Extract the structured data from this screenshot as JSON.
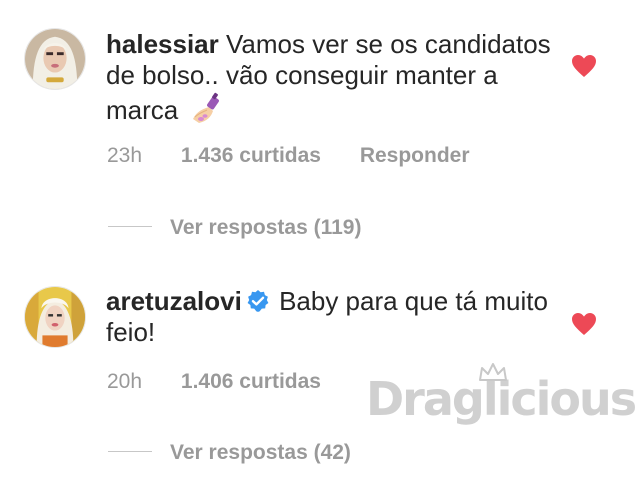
{
  "comments": [
    {
      "username": "halessiar",
      "text": "Vamos ver se os candidatos de bolso.. vão conseguir manter a marca",
      "emoji": "nail-polish",
      "time": "23h",
      "likes": "1.436 curtidas",
      "reply": "Responder",
      "view_replies": "Ver respostas (119)",
      "verified": false,
      "liked": true
    },
    {
      "username": "aretuzalovi",
      "text": "Baby para que tá muito feio!",
      "time": "20h",
      "likes": "1.406 curtidas",
      "view_replies": "Ver respostas (42)",
      "verified": true,
      "liked": true
    }
  ],
  "watermark": {
    "text": "Draglicious"
  },
  "colors": {
    "text": "#262626",
    "meta": "#999999",
    "heart": "#ed4956",
    "verified": "#3897f0"
  }
}
